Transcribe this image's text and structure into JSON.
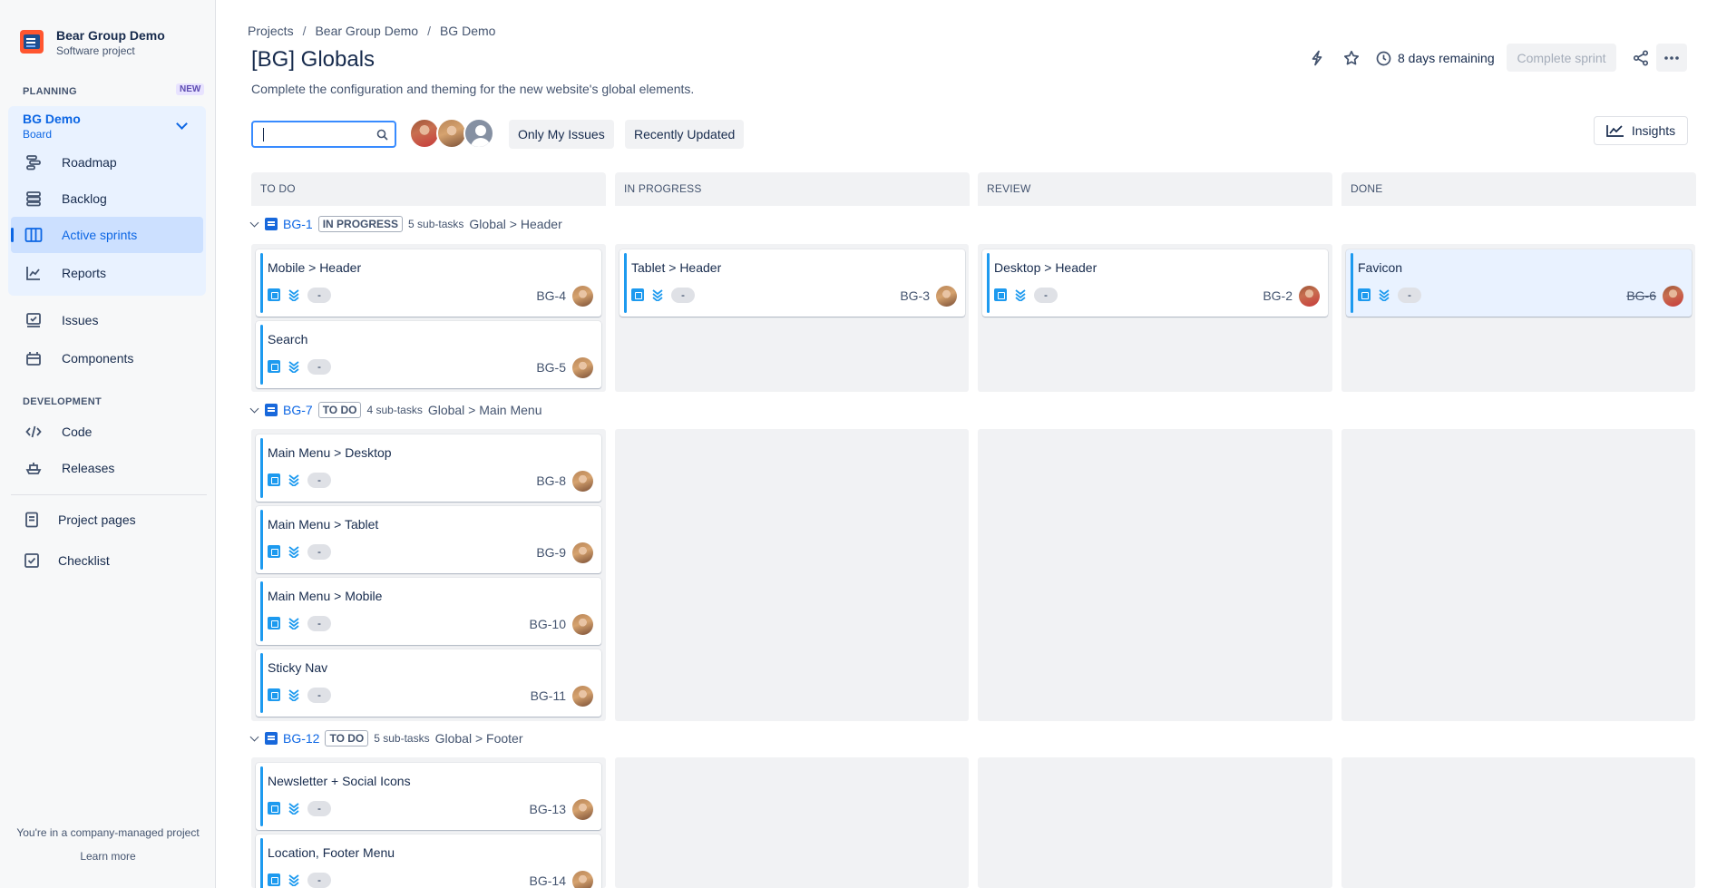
{
  "project": {
    "name": "Bear Group Demo",
    "type": "Software project"
  },
  "sidebar": {
    "planning_label": "PLANNING",
    "new_badge": "NEW",
    "board": {
      "name": "BG Demo",
      "sub": "Board"
    },
    "planning_items": [
      {
        "label": "Roadmap",
        "icon": "roadmap-icon"
      },
      {
        "label": "Backlog",
        "icon": "backlog-icon"
      },
      {
        "label": "Active sprints",
        "icon": "board-icon",
        "active": true
      },
      {
        "label": "Reports",
        "icon": "chart-icon"
      }
    ],
    "other_items": [
      {
        "label": "Issues",
        "icon": "issues-icon"
      },
      {
        "label": "Components",
        "icon": "components-icon"
      }
    ],
    "development_label": "DEVELOPMENT",
    "development_items": [
      {
        "label": "Code",
        "icon": "code-icon"
      },
      {
        "label": "Releases",
        "icon": "ship-icon"
      }
    ],
    "page_items": [
      {
        "label": "Project pages",
        "icon": "page-icon"
      },
      {
        "label": "Checklist",
        "icon": "checkbox-icon"
      }
    ],
    "footer_note": "You're in a company-managed project",
    "learn_more": "Learn more"
  },
  "breadcrumbs": [
    "Projects",
    "Bear Group Demo",
    "BG Demo"
  ],
  "header": {
    "title": "[BG] Globals",
    "description": "Complete the configuration and theming for the new website's global elements.",
    "remaining": "8 days remaining",
    "complete_sprint": "Complete sprint"
  },
  "filters": {
    "search_value": "",
    "only_my_issues": "Only My Issues",
    "recently_updated": "Recently Updated",
    "insights": "Insights"
  },
  "columns": [
    "TO DO",
    "IN PROGRESS",
    "REVIEW",
    "DONE"
  ],
  "swimlanes": [
    {
      "key": "BG-1",
      "status": "IN PROGRESS",
      "subtasks": "5 sub-tasks",
      "summary": "Global > Header",
      "cards": [
        {
          "title": "Mobile > Header",
          "key": "BG-4",
          "estimate": "-",
          "column": 0
        },
        {
          "title": "Search",
          "key": "BG-5",
          "estimate": "-",
          "column": 0
        },
        {
          "title": "Tablet > Header",
          "key": "BG-3",
          "estimate": "-",
          "column": 1
        },
        {
          "title": "Desktop > Header",
          "key": "BG-2",
          "estimate": "-",
          "column": 2
        },
        {
          "title": "Favicon",
          "key": "BG-6",
          "estimate": "-",
          "column": 3
        }
      ]
    },
    {
      "key": "BG-7",
      "status": "TO DO",
      "subtasks": "4 sub-tasks",
      "summary": "Global > Main Menu",
      "cards": [
        {
          "title": "Main Menu > Desktop",
          "key": "BG-8",
          "estimate": "-",
          "column": 0
        },
        {
          "title": "Main Menu > Tablet",
          "key": "BG-9",
          "estimate": "-",
          "column": 0
        },
        {
          "title": "Main Menu > Mobile",
          "key": "BG-10",
          "estimate": "-",
          "column": 0
        },
        {
          "title": "Sticky Nav",
          "key": "BG-11",
          "estimate": "-",
          "column": 0
        }
      ]
    },
    {
      "key": "BG-12",
      "status": "TO DO",
      "subtasks": "5 sub-tasks",
      "summary": "Global > Footer",
      "cards": [
        {
          "title": "Newsletter + Social Icons",
          "key": "BG-13",
          "estimate": "-",
          "column": 0
        },
        {
          "title": "Location, Footer Menu",
          "key": "BG-14",
          "estimate": "-",
          "column": 0
        }
      ]
    }
  ],
  "colors": {
    "accent": "#0c66e4",
    "card_bar": "#1d9aef",
    "column_bg": "#f1f2f4"
  }
}
